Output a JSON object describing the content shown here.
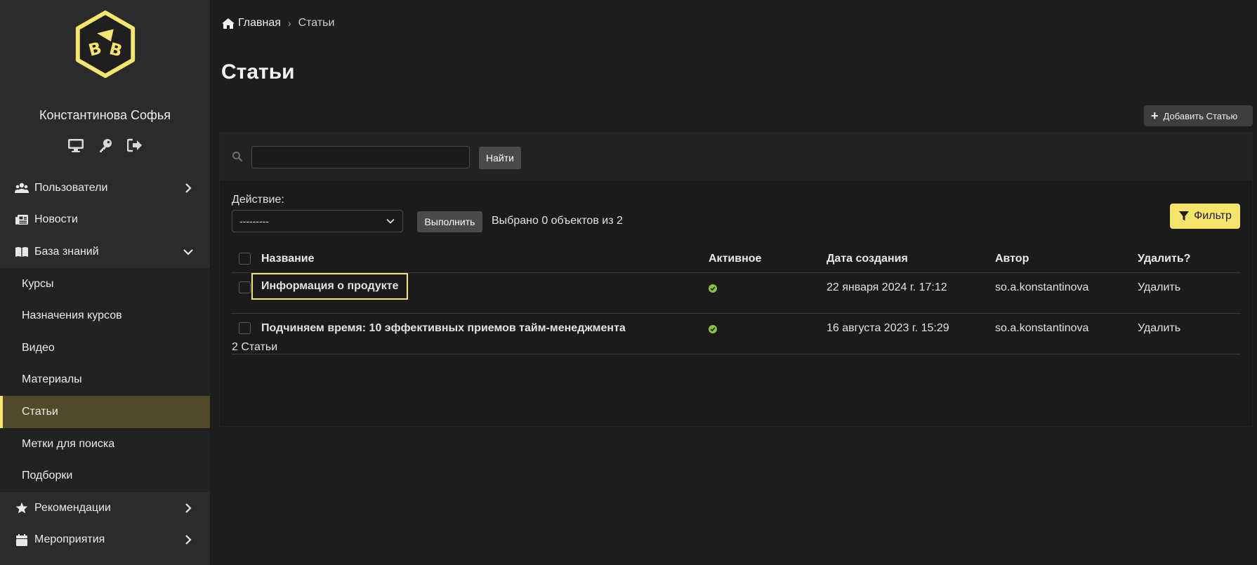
{
  "colors": {
    "accent": "#f6e66d",
    "sidebar_bg": "#2b2b2b",
    "active_bg": "#514a2b",
    "check": "#8ac23d"
  },
  "user": {
    "name": "Константинова Софья",
    "actions": [
      "monitor-icon",
      "key-icon",
      "logout-icon"
    ]
  },
  "sidebar": {
    "items": [
      {
        "label": "Пользователи",
        "icon": "users-icon",
        "chevron": "right"
      },
      {
        "label": "Новости",
        "icon": "newspaper-icon"
      },
      {
        "label": "База знаний",
        "icon": "book-icon",
        "chevron": "down"
      }
    ],
    "sub_items": [
      {
        "label": "Курсы"
      },
      {
        "label": "Назначения курсов"
      },
      {
        "label": "Видео"
      },
      {
        "label": "Материалы"
      },
      {
        "label": "Статьи",
        "active": true
      },
      {
        "label": "Метки для поиска"
      },
      {
        "label": "Подборки"
      }
    ],
    "bottom_items": [
      {
        "label": "Рекомендации",
        "icon": "star-icon",
        "chevron": "right"
      },
      {
        "label": "Мероприятия",
        "icon": "calendar-icon",
        "chevron": "right"
      }
    ]
  },
  "breadcrumb": {
    "home": "Главная",
    "separator": "›",
    "current": "Статьи"
  },
  "page": {
    "title": "Статьи",
    "add_button": "Добавить Статью"
  },
  "search": {
    "value": "",
    "button": "Найти"
  },
  "actions": {
    "label": "Действие:",
    "selected": "---------",
    "run_button": "Выполнить",
    "selected_info": "Выбрано 0 объектов из 2"
  },
  "filter": {
    "label": "Фильтр"
  },
  "table": {
    "headers": {
      "title": "Название",
      "active": "Активное",
      "created": "Дата создания",
      "author": "Автор",
      "delete": "Удалить?"
    },
    "rows": [
      {
        "title": "Информация о продукте",
        "active": true,
        "created": "22 января 2024 г. 17:12",
        "author": "so.a.konstantinova",
        "delete": "Удалить"
      },
      {
        "title": "Подчиняем время: 10 эффективных приемов тайм-менеджмента",
        "active": true,
        "created": "16 августа 2023 г. 15:29",
        "author": "so.a.konstantinova",
        "delete": "Удалить"
      }
    ]
  },
  "footer": {
    "count": "2 Статьи"
  }
}
